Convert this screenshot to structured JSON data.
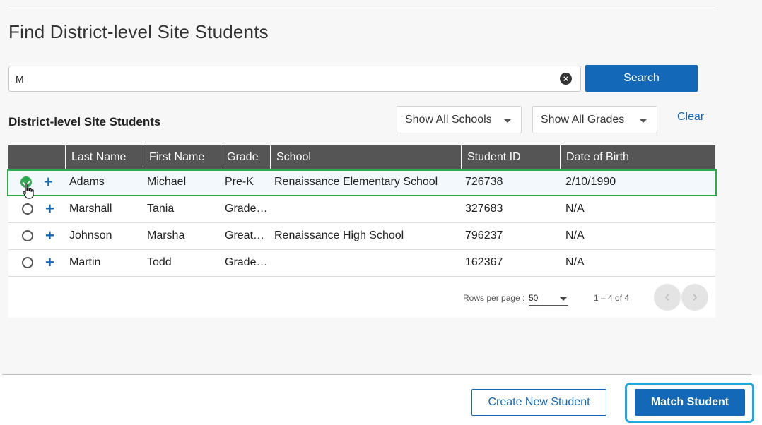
{
  "page": {
    "title": "Find District-level Site Students"
  },
  "search": {
    "value": "M",
    "button_label": "Search"
  },
  "section": {
    "title": "District-level Site Students"
  },
  "filters": {
    "schools_label": "Show All Schools",
    "grades_label": "Show All Grades",
    "clear_label": "Clear"
  },
  "table": {
    "columns": [
      "Last Name",
      "First Name",
      "Grade",
      "School",
      "Student ID",
      "Date of Birth"
    ],
    "rows": [
      {
        "last": "Adams",
        "first": "Michael",
        "grade": "Pre-K",
        "school": "Renaissance Elementary School",
        "id": "726738",
        "dob": "2/10/1990",
        "selected": true
      },
      {
        "last": "Marshall",
        "first": "Tania",
        "grade": "Grade…",
        "school": "",
        "id": "327683",
        "dob": "N/A",
        "selected": false
      },
      {
        "last": "Johnson",
        "first": "Marsha",
        "grade": "Great…",
        "school": "Renaissance High School",
        "id": "796237",
        "dob": "N/A",
        "selected": false
      },
      {
        "last": "Martin",
        "first": "Todd",
        "grade": "Grade…",
        "school": "",
        "id": "162367",
        "dob": "N/A",
        "selected": false
      }
    ]
  },
  "pagination": {
    "rows_per_page_label": "Rows per page :",
    "rows_per_page": "50",
    "range": "1 – 4 of 4",
    "prev_icon": "‹",
    "next_icon": "›"
  },
  "footer": {
    "create_label": "Create New Student",
    "match_label": "Match Student"
  },
  "colors": {
    "primary": "#1468b8",
    "selected_border": "#2eaa4f",
    "header_bg": "#555555",
    "focus_ring": "#1fa7e0"
  }
}
